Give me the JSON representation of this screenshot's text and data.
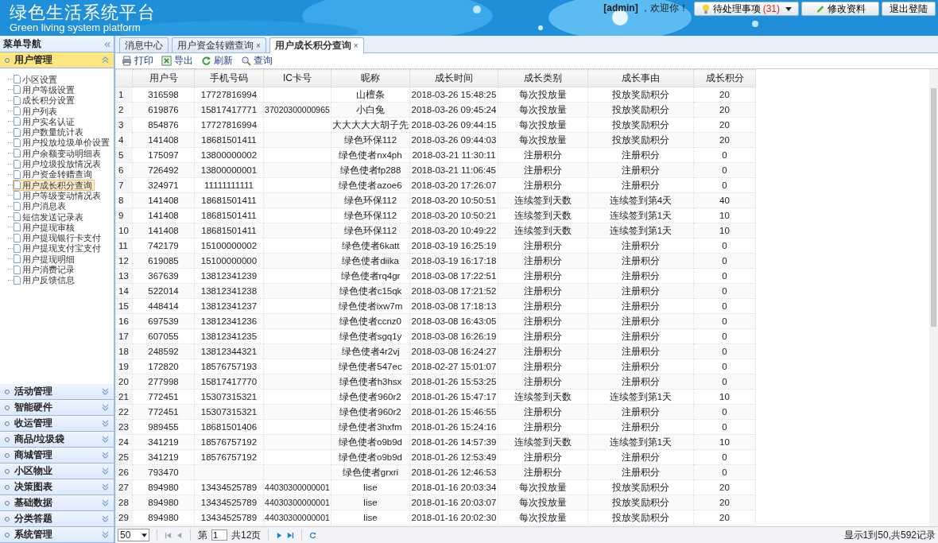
{
  "header": {
    "title": "绿色生活系统平台",
    "subtitle": "Green living system platform",
    "user": "[admin]",
    "welcome": "，欢迎你！",
    "buttons": [
      {
        "kind": "pending",
        "label": "待处理事项",
        "count": "(31)"
      },
      {
        "kind": "edit",
        "label": "修改资料"
      },
      {
        "kind": "logout",
        "label": "退出登陆"
      }
    ]
  },
  "sidebar": {
    "title": "菜单导航",
    "collapse": "«",
    "groups": [
      {
        "label": "用户管理",
        "expanded": true,
        "items": [
          {
            "label": "小区设置",
            "selected": false
          },
          {
            "label": "用户等级设置",
            "selected": false
          },
          {
            "label": "成长积分设置",
            "selected": false
          },
          {
            "label": "用户列表",
            "selected": false
          },
          {
            "label": "用户实名认证",
            "selected": false
          },
          {
            "label": "用户数量统计表",
            "selected": false
          },
          {
            "label": "用户投放垃圾单价设置",
            "selected": false
          },
          {
            "label": "用户余额变动明细表",
            "selected": false
          },
          {
            "label": "用户垃圾投放情况表",
            "selected": false
          },
          {
            "label": "用户资金转赠查询",
            "selected": false
          },
          {
            "label": "用户成长积分查询",
            "selected": true
          },
          {
            "label": "用户等级变动情况表",
            "selected": false
          },
          {
            "label": "用户消息表",
            "selected": false
          },
          {
            "label": "短信发送记录表",
            "selected": false
          },
          {
            "label": "用户提现审核",
            "selected": false
          },
          {
            "label": "用户提现银行卡支付",
            "selected": false
          },
          {
            "label": "用户提现支付宝支付",
            "selected": false
          },
          {
            "label": "用户提现明细",
            "selected": false
          },
          {
            "label": "用户消费记录",
            "selected": false
          },
          {
            "label": "用户反馈信息",
            "selected": false
          }
        ]
      },
      {
        "label": "活动管理",
        "expanded": false
      },
      {
        "label": "智能硬件",
        "expanded": false
      },
      {
        "label": "收运管理",
        "expanded": false
      },
      {
        "label": "商品/垃圾袋",
        "expanded": false
      },
      {
        "label": "商城管理",
        "expanded": false
      },
      {
        "label": "小区物业",
        "expanded": false
      },
      {
        "label": "决策图表",
        "expanded": false
      },
      {
        "label": "基础数据",
        "expanded": false
      },
      {
        "label": "分类答题",
        "expanded": false
      },
      {
        "label": "系统管理",
        "expanded": false
      }
    ]
  },
  "tabs": [
    {
      "label": "消息中心",
      "selected": false,
      "closable": false
    },
    {
      "label": "用户资金转赠查询",
      "selected": false,
      "closable": true,
      "close": "×"
    },
    {
      "label": "用户成长积分查询",
      "selected": true,
      "closable": true,
      "close": "×"
    }
  ],
  "toolbar": [
    {
      "kind": "print",
      "label": "打印"
    },
    {
      "kind": "export",
      "label": "导出"
    },
    {
      "kind": "refresh",
      "label": "刷新"
    },
    {
      "kind": "search",
      "label": "查询"
    }
  ],
  "table": {
    "columns": [
      "",
      "用户号",
      "手机号码",
      "IC卡号",
      "昵称",
      "成长时间",
      "成长类别",
      "成长事由",
      "成长积分"
    ],
    "rows": [
      [
        "1",
        "316598",
        "17727816994",
        "",
        "山檀条",
        "2018-03-26 15:48:25",
        "每次投放量",
        "投放奖励积分",
        "20"
      ],
      [
        "2",
        "619876",
        "15817417771",
        "37020300000965",
        "小白兔",
        "2018-03-26 09:45:24",
        "每次投放量",
        "投放奖励积分",
        "20"
      ],
      [
        "3",
        "854876",
        "17727816994",
        "",
        "大大大大大胡子先",
        "2018-03-26 09:44:15",
        "每次投放量",
        "投放奖励积分",
        "20"
      ],
      [
        "4",
        "141408",
        "18681501411",
        "",
        "绿色环保112",
        "2018-03-26 09:44:03",
        "每次投放量",
        "投放奖励积分",
        "20"
      ],
      [
        "5",
        "175097",
        "13800000002",
        "",
        "绿色使者nx4ph",
        "2018-03-21 11:30:11",
        "注册积分",
        "注册积分",
        "0"
      ],
      [
        "6",
        "726492",
        "13800000001",
        "",
        "绿色使者fp288",
        "2018-03-21 11:06:45",
        "注册积分",
        "注册积分",
        "0"
      ],
      [
        "7",
        "324971",
        "11111111111",
        "",
        "绿色使者azoe6",
        "2018-03-20 17:26:07",
        "注册积分",
        "注册积分",
        "0"
      ],
      [
        "8",
        "141408",
        "18681501411",
        "",
        "绿色环保112",
        "2018-03-20 10:50:51",
        "连续签到天数",
        "连续签到第4天",
        "40"
      ],
      [
        "9",
        "141408",
        "18681501411",
        "",
        "绿色环保112",
        "2018-03-20 10:50:21",
        "连续签到天数",
        "连续签到第1天",
        "10"
      ],
      [
        "10",
        "141408",
        "18681501411",
        "",
        "绿色环保112",
        "2018-03-20 10:49:22",
        "连续签到天数",
        "连续签到第1天",
        "10"
      ],
      [
        "11",
        "742179",
        "15100000002",
        "",
        "绿色使者6katt",
        "2018-03-19 16:25:19",
        "注册积分",
        "注册积分",
        "0"
      ],
      [
        "12",
        "619085",
        "15100000000",
        "",
        "绿色使者diika",
        "2018-03-19 16:17:18",
        "注册积分",
        "注册积分",
        "0"
      ],
      [
        "13",
        "367639",
        "13812341239",
        "",
        "绿色使者rq4gr",
        "2018-03-08 17:22:51",
        "注册积分",
        "注册积分",
        "0"
      ],
      [
        "14",
        "522014",
        "13812341238",
        "",
        "绿色使者c15qk",
        "2018-03-08 17:21:52",
        "注册积分",
        "注册积分",
        "0"
      ],
      [
        "15",
        "448414",
        "13812341237",
        "",
        "绿色使者ixw7m",
        "2018-03-08 17:18:13",
        "注册积分",
        "注册积分",
        "0"
      ],
      [
        "16",
        "697539",
        "13812341236",
        "",
        "绿色使者ccnz0",
        "2018-03-08 16:43:05",
        "注册积分",
        "注册积分",
        "0"
      ],
      [
        "17",
        "607055",
        "13812341235",
        "",
        "绿色使者sgq1y",
        "2018-03-08 16:26:19",
        "注册积分",
        "注册积分",
        "0"
      ],
      [
        "18",
        "248592",
        "13812344321",
        "",
        "绿色使者4r2vj",
        "2018-03-08 16:24:27",
        "注册积分",
        "注册积分",
        "0"
      ],
      [
        "19",
        "172820",
        "18576757193",
        "",
        "绿色使者547ec",
        "2018-02-27 15:01:07",
        "注册积分",
        "注册积分",
        "0"
      ],
      [
        "20",
        "277998",
        "15817417770",
        "",
        "绿色使者h3hsx",
        "2018-01-26 15:53:25",
        "注册积分",
        "注册积分",
        "0"
      ],
      [
        "21",
        "772451",
        "15307315321",
        "",
        "绿色使者960r2",
        "2018-01-26 15:47:17",
        "连续签到天数",
        "连续签到第1天",
        "10"
      ],
      [
        "22",
        "772451",
        "15307315321",
        "",
        "绿色使者960r2",
        "2018-01-26 15:46:55",
        "注册积分",
        "注册积分",
        "0"
      ],
      [
        "23",
        "989455",
        "18681501406",
        "",
        "绿色使者3hxfm",
        "2018-01-26 15:24:16",
        "注册积分",
        "注册积分",
        "0"
      ],
      [
        "24",
        "341219",
        "18576757192",
        "",
        "绿色使者o9b9d",
        "2018-01-26 14:57:39",
        "连续签到天数",
        "连续签到第1天",
        "10"
      ],
      [
        "25",
        "341219",
        "18576757192",
        "",
        "绿色使者o9b9d",
        "2018-01-26 12:53:49",
        "注册积分",
        "注册积分",
        "0"
      ],
      [
        "26",
        "793470",
        "",
        "",
        "绿色使者grxri",
        "2018-01-26 12:46:53",
        "注册积分",
        "注册积分",
        "0"
      ],
      [
        "27",
        "894980",
        "13434525789",
        "44030300000001",
        "lise",
        "2018-01-16 20:03:34",
        "每次投放量",
        "投放奖励积分",
        "20"
      ],
      [
        "28",
        "894980",
        "13434525789",
        "44030300000001",
        "lise",
        "2018-01-16 20:03:07",
        "每次投放量",
        "投放奖励积分",
        "20"
      ],
      [
        "29",
        "894980",
        "13434525789",
        "44030300000001",
        "lise",
        "2018-01-16 20:02:30",
        "每次投放量",
        "投放奖励积分",
        "20"
      ]
    ]
  },
  "pager": {
    "page_size": "50",
    "page_prefix": "第",
    "page": "1",
    "page_total": "共12页",
    "summary": "显示1到50,共592记录"
  }
}
